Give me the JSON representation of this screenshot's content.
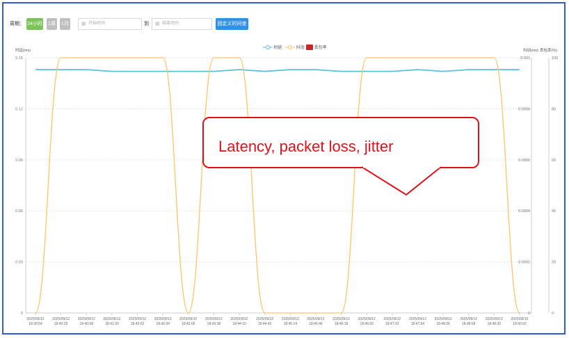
{
  "toolbar": {
    "period_label": "周期：",
    "btn_24h": "24小时",
    "btn_week": "1周",
    "btn_month": "1月",
    "start_placeholder": "开始时间",
    "to_label": "到",
    "end_placeholder": "结束时间",
    "query_label": "固定义时间查询"
  },
  "legend": {
    "latency": "时延",
    "jitter": "抖动",
    "loss": "丢包率"
  },
  "callout": {
    "text": "Latency, packet loss, jitter"
  },
  "colors": {
    "latency": "#5bc0de",
    "jitter": "#ffc266",
    "loss": "#c62828",
    "query_button": "#2f92ea",
    "active_button": "#7cc45a",
    "callout": "#e0101a"
  },
  "chart_data": {
    "type": "line",
    "left_axis": {
      "label": "时延(ms)",
      "ticks": [
        "0",
        "0.03",
        "0.06",
        "0.09",
        "0.12",
        "0.15"
      ],
      "ylim": [
        0,
        0.15
      ]
    },
    "right_axis_jitter": {
      "label": "抖动(ms)",
      "ticks": [
        "0",
        "0.0002",
        "0.0004",
        "0.0006",
        "0.0008",
        "0.001"
      ],
      "ylim": [
        0,
        0.001
      ]
    },
    "right_axis_loss": {
      "label": "丢包率(%)",
      "ticks": [
        "0",
        "20",
        "40",
        "60",
        "80",
        "100"
      ],
      "ylim": [
        0,
        100
      ]
    },
    "x_labels": [
      [
        "2025/09/12",
        "18:39:54"
      ],
      [
        "2025/09/12",
        "18:40:26"
      ],
      [
        "2025/09/12",
        "18:40:58"
      ],
      [
        "2025/09/12",
        "18:41:30"
      ],
      [
        "2025/09/12",
        "18:42:02"
      ],
      [
        "2025/09/12",
        "18:42:34"
      ],
      [
        "2025/09/12",
        "18:43:06"
      ],
      [
        "2025/09/12",
        "18:43:38"
      ],
      [
        "2025/09/12",
        "18:44:10"
      ],
      [
        "2025/09/12",
        "18:44:42"
      ],
      [
        "2025/09/12",
        "18:45:14"
      ],
      [
        "2025/09/12",
        "18:45:46"
      ],
      [
        "2025/09/12",
        "18:46:18"
      ],
      [
        "2025/09/12",
        "18:46:50"
      ],
      [
        "2025/09/12",
        "18:47:22"
      ],
      [
        "2025/09/12",
        "18:47:54"
      ],
      [
        "2025/09/12",
        "18:48:26"
      ],
      [
        "2025/09/12",
        "18:48:58"
      ],
      [
        "2025/09/12",
        "18:49:30"
      ],
      [
        "2025/09/12",
        "18:50:02"
      ]
    ],
    "series": [
      {
        "name": "时延",
        "axis": "left",
        "values": [
          0.143,
          0.143,
          0.143,
          0.142,
          0.142,
          0.142,
          0.142,
          0.142,
          0.143,
          0.142,
          0.143,
          0.143,
          0.142,
          0.142,
          0.142,
          0.143,
          0.142,
          0.143,
          0.143,
          0.143
        ]
      },
      {
        "name": "抖动",
        "axis": "right_jitter",
        "values": [
          0,
          0.001,
          0.001,
          0.001,
          0.001,
          0.001,
          0,
          0.001,
          0.001,
          0,
          0,
          0,
          0,
          0.001,
          0.001,
          0.001,
          0.001,
          0.001,
          0.001,
          0
        ]
      },
      {
        "name": "丢包率",
        "axis": "right_loss",
        "values": []
      }
    ],
    "grid": true,
    "legend_position": "top-center"
  }
}
